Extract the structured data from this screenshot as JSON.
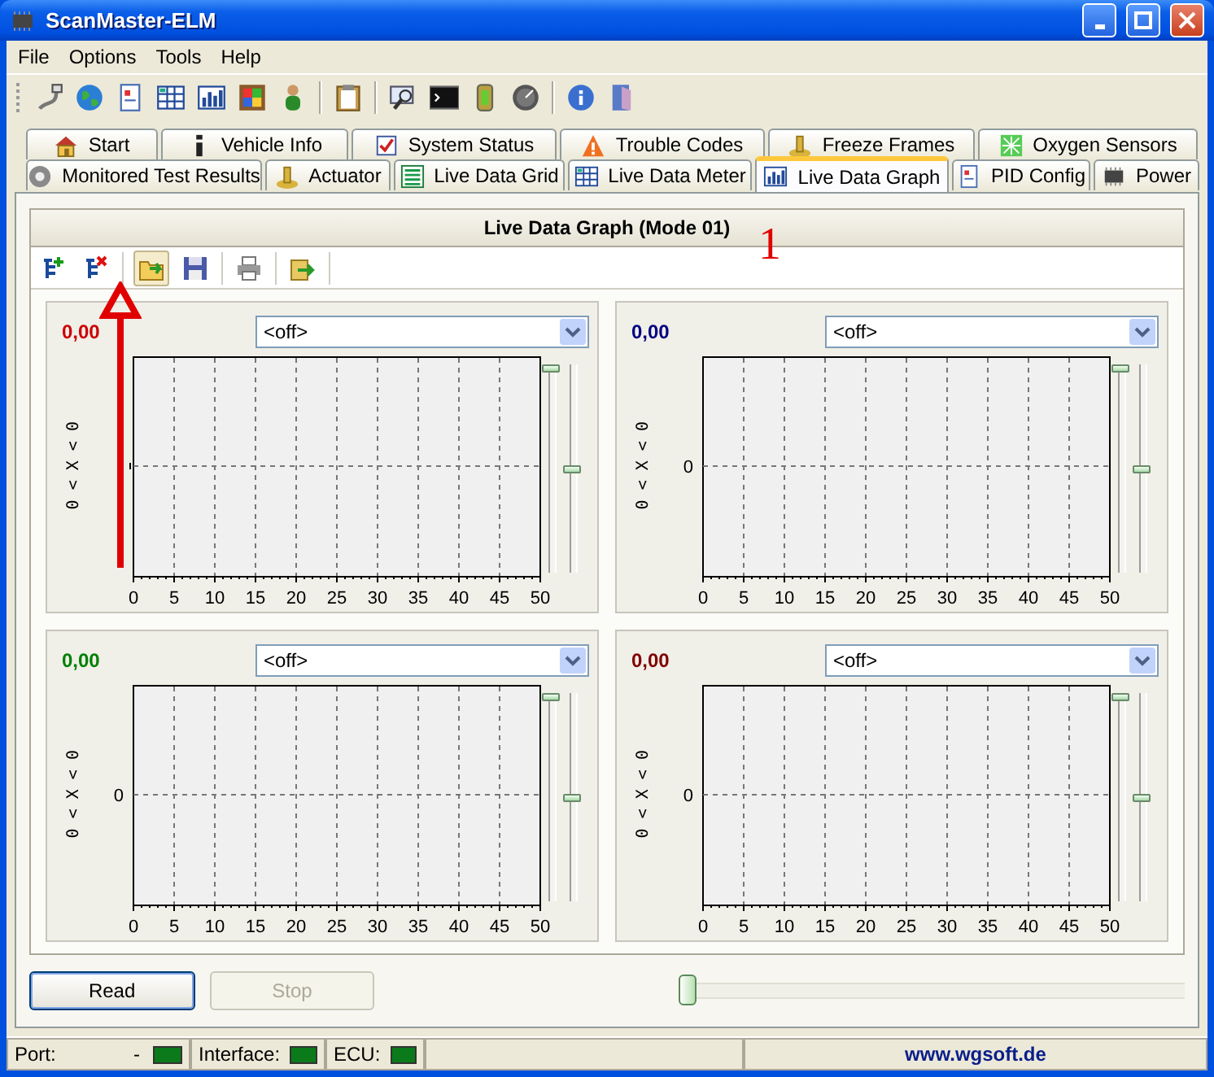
{
  "window": {
    "title": "ScanMaster-ELM"
  },
  "menu": [
    "File",
    "Options",
    "Tools",
    "Help"
  ],
  "tab_rows": [
    [
      {
        "label": "Start",
        "selected": false
      },
      {
        "label": "Vehicle Info",
        "selected": false
      },
      {
        "label": "System Status",
        "selected": false
      },
      {
        "label": "Trouble Codes",
        "selected": false
      },
      {
        "label": "Freeze Frames",
        "selected": false
      },
      {
        "label": "Oxygen Sensors",
        "selected": false
      }
    ],
    [
      {
        "label": "Monitored Test Results",
        "selected": false
      },
      {
        "label": "Actuator",
        "selected": false
      },
      {
        "label": "Live Data Grid",
        "selected": false
      },
      {
        "label": "Live Data Meter",
        "selected": false
      },
      {
        "label": "Live Data Graph",
        "selected": true
      },
      {
        "label": "PID Config",
        "selected": false
      },
      {
        "label": "Power",
        "selected": false
      }
    ]
  ],
  "page_header": "Live Data Graph (Mode 01)",
  "annotation": {
    "label": "1"
  },
  "graphs": [
    {
      "value": "0,00",
      "color": "#cc0000",
      "selection": "<off>",
      "axis_label": "0 < X < 0",
      "x_labels": [
        "0",
        "5",
        "10",
        "15",
        "20",
        "25",
        "30",
        "35",
        "40",
        "45",
        "50"
      ],
      "scale_slider": {
        "level": 1
      },
      "offset_slider": {
        "level": 0.5
      }
    },
    {
      "value": "0,00",
      "color": "#000080",
      "selection": "<off>",
      "axis_label": "0 < X < 0",
      "x_labels": [
        "0",
        "5",
        "10",
        "15",
        "20",
        "25",
        "30",
        "35",
        "40",
        "45",
        "50"
      ],
      "y_label": "0",
      "scale_slider": {
        "level": 1
      },
      "offset_slider": {
        "level": 0.5
      }
    },
    {
      "value": "0,00",
      "color": "#008000",
      "selection": "<off>",
      "axis_label": "0 < X < 0",
      "x_labels": [
        "0",
        "5",
        "10",
        "15",
        "20",
        "25",
        "30",
        "35",
        "40",
        "45",
        "50"
      ],
      "y_label": "0",
      "scale_slider": {
        "level": 1
      },
      "offset_slider": {
        "level": 0.5
      }
    },
    {
      "value": "0,00",
      "color": "#800000",
      "selection": "<off>",
      "axis_label": "0 < X < 0",
      "x_labels": [
        "0",
        "5",
        "10",
        "15",
        "20",
        "25",
        "30",
        "35",
        "40",
        "45",
        "50"
      ],
      "y_label": "0",
      "scale_slider": {
        "level": 1
      },
      "offset_slider": {
        "level": 0.5
      }
    }
  ],
  "buttons": [
    {
      "label": "Read",
      "disabled": false
    },
    {
      "label": "Stop",
      "disabled": true
    }
  ],
  "position_slider": {
    "level": 0
  },
  "status_bar": {
    "port_label": "Port:",
    "port_value": "-",
    "interface_label": "Interface:",
    "ecu_label": "ECU:",
    "website": "www.wgsoft.de"
  }
}
